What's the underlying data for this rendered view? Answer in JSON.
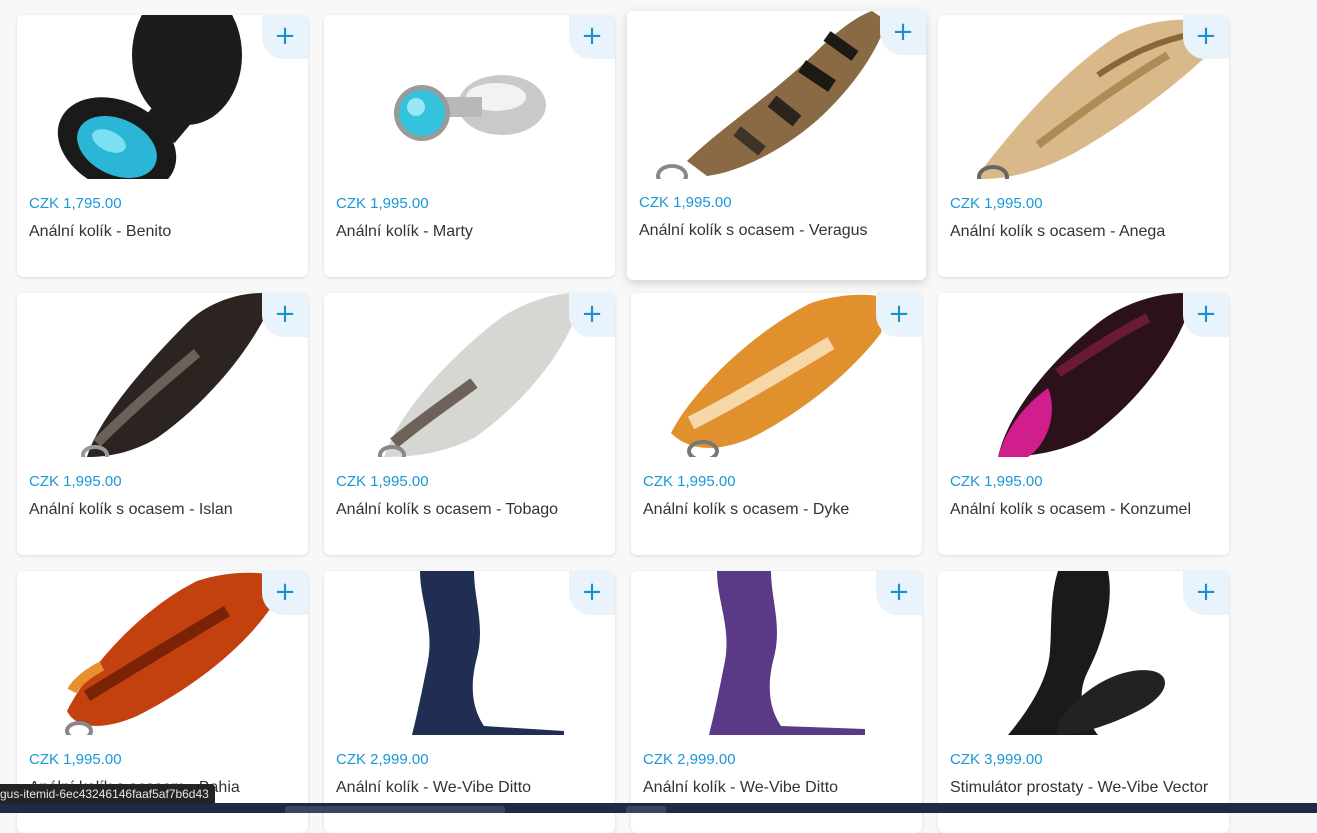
{
  "add_symbol": "+",
  "products": [
    {
      "price": "CZK 1,795.00",
      "name": "Anální kolík - Benito",
      "image": "black-plug-blue-jewel"
    },
    {
      "price": "CZK 1,995.00",
      "name": "Anální kolík - Marty",
      "image": "steel-plug-blue-jewel"
    },
    {
      "price": "CZK 1,995.00",
      "name": "Anální kolík s ocasem - Veragus",
      "image": "striped-tail"
    },
    {
      "price": "CZK 1,995.00",
      "name": "Anální kolík s ocasem - Anega",
      "image": "blonde-tail"
    },
    {
      "price": "CZK 1,995.00",
      "name": "Anální kolík s ocasem - Islan",
      "image": "dark-brown-tail"
    },
    {
      "price": "CZK 1,995.00",
      "name": "Anální kolík s ocasem - Tobago",
      "image": "grey-white-tail"
    },
    {
      "price": "CZK 1,995.00",
      "name": "Anální kolík s ocasem - Dyke",
      "image": "orange-fox-tail"
    },
    {
      "price": "CZK 1,995.00",
      "name": "Anální kolík s ocasem - Konzumel",
      "image": "black-pink-tail"
    },
    {
      "price": "CZK 1,995.00",
      "name": "Anální kolík s ocasem - Bahia",
      "image": "red-fox-tail"
    },
    {
      "price": "CZK 2,999.00",
      "name": "Anální kolík - We-Vibe Ditto",
      "image": "navy-plug"
    },
    {
      "price": "CZK 2,999.00",
      "name": "Anální kolík - We-Vibe Ditto",
      "image": "purple-plug"
    },
    {
      "price": "CZK 3,999.00",
      "name": "Stimulátor prostaty - We-Vibe Vector",
      "image": "black-prostate-stimulator"
    }
  ],
  "status_bar": {
    "text": "gus-itemid-6ec43246146faaf5af7b6d43"
  },
  "colors": {
    "accent": "#1a98d5",
    "add_bg": "#e9f3fb",
    "text": "#333333"
  }
}
